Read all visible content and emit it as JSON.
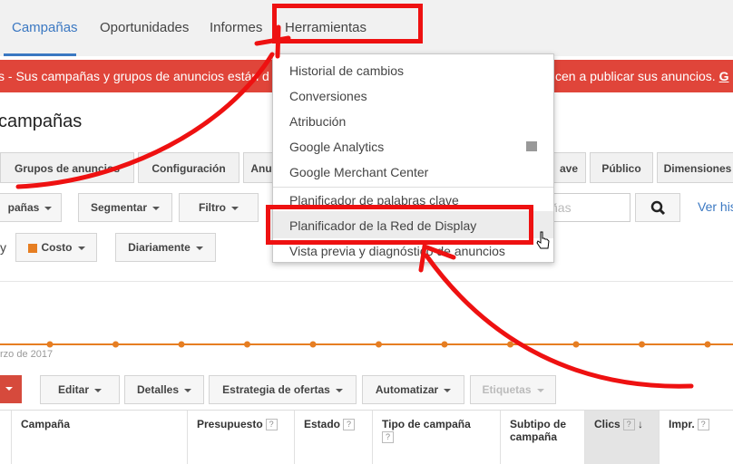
{
  "nav": {
    "tabs": [
      {
        "label": "Campañas",
        "active": true
      },
      {
        "label": "Oportunidades",
        "active": false
      },
      {
        "label": "Informes",
        "active": false
      },
      {
        "label": "Herramientas",
        "active": false
      }
    ]
  },
  "alert": {
    "text_left": "s - Sus campañas y grupos de anuncios están d",
    "text_right": "cen a publicar sus anuncios. ",
    "link": "G"
  },
  "page": {
    "title": "campañas"
  },
  "subtabs": [
    "Grupos de anuncios",
    "Configuración",
    "Anu",
    "ave",
    "Público",
    "Dimensiones"
  ],
  "filters": {
    "campaigns": "pañas",
    "segment": "Segmentar",
    "filter": "Filtro",
    "search_placeholder": "ñas",
    "view_history": "Ver his"
  },
  "metrics": {
    "y_prefix": "y",
    "metric": "Costo",
    "metric_color": "#e67e22",
    "period": "Diariamente"
  },
  "chart_data": {
    "type": "line",
    "x_label_visible": "rzo de 2017",
    "points": 12,
    "values": [
      0,
      0,
      0,
      0,
      0,
      0,
      0,
      0,
      0,
      0,
      0,
      0
    ],
    "color": "#e67e22"
  },
  "actions": [
    "Editar",
    "Detalles",
    "Estrategia de ofertas",
    "Automatizar",
    "Etiquetas"
  ],
  "table": {
    "columns": [
      {
        "label": "Campaña",
        "help": false
      },
      {
        "label": "Presupuesto",
        "help": true
      },
      {
        "label": "Estado",
        "help": true
      },
      {
        "label": "Tipo de campaña",
        "help": true
      },
      {
        "label": "Subtipo de campaña",
        "help": false
      },
      {
        "label": "Clics",
        "help": true,
        "sorted": true
      },
      {
        "label": "Impr.",
        "help": true
      }
    ]
  },
  "tools_menu": {
    "items": [
      "Historial de cambios",
      "Conversiones",
      "Atribución",
      "Google Analytics",
      "Google Merchant Center",
      "Planificador de palabras clave",
      "Planificador de la Red de Display",
      "Vista previa y diagnóstico de anuncios"
    ]
  },
  "colors": {
    "accent": "#3b78c2",
    "alert": "#e0453a",
    "annotation": "#ee1111"
  }
}
